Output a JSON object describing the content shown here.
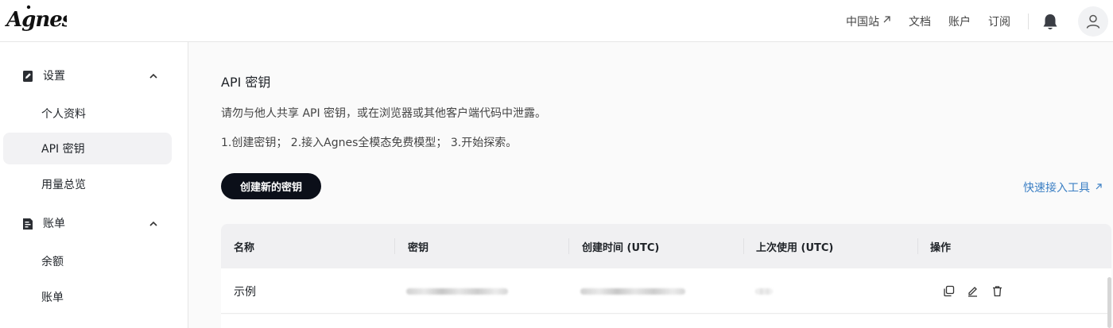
{
  "header": {
    "logo_text": "Agnes",
    "nav": [
      {
        "label": "中国站",
        "external": true,
        "icon": "arrow-up-right-icon"
      },
      {
        "label": "文档"
      },
      {
        "label": "账户"
      },
      {
        "label": "订阅"
      }
    ],
    "notification_icon": "bell-icon",
    "avatar_icon": "user-icon"
  },
  "sidebar": {
    "groups": [
      {
        "label": "设置",
        "icon": "document-edit-icon",
        "expanded": true,
        "items": [
          {
            "label": "个人资料",
            "active": false
          },
          {
            "label": "API 密钥",
            "active": true
          },
          {
            "label": "用量总览",
            "active": false
          }
        ]
      },
      {
        "label": "账单",
        "icon": "receipt-icon",
        "expanded": true,
        "items": [
          {
            "label": "余额",
            "active": false
          },
          {
            "label": "账单",
            "active": false
          }
        ]
      }
    ]
  },
  "main": {
    "title": "API 密钥",
    "warning": "请勿与他人共享 API 密钥，或在浏览器或其他客户端代码中泄露。",
    "steps": "1.创建密钥； 2.接入Agnes全模态免费模型； 3.开始探索。",
    "create_button": "创建新的密钥",
    "quick_link": "快速接入工具",
    "table": {
      "columns": [
        "名称",
        "密钥",
        "创建时间 (UTC)",
        "上次使用 (UTC)",
        "操作"
      ],
      "rows": [
        {
          "name": "示例",
          "key_redacted": true,
          "created_redacted": true,
          "last_used_redacted": true
        }
      ],
      "row_actions": [
        "copy-icon",
        "edit-icon",
        "delete-icon"
      ]
    }
  },
  "colors": {
    "primary_button": "#0b0f19",
    "link": "#3b7fc4",
    "active_sidebar_bg": "#f2f2f4",
    "table_header_bg": "#f0f0f2"
  }
}
